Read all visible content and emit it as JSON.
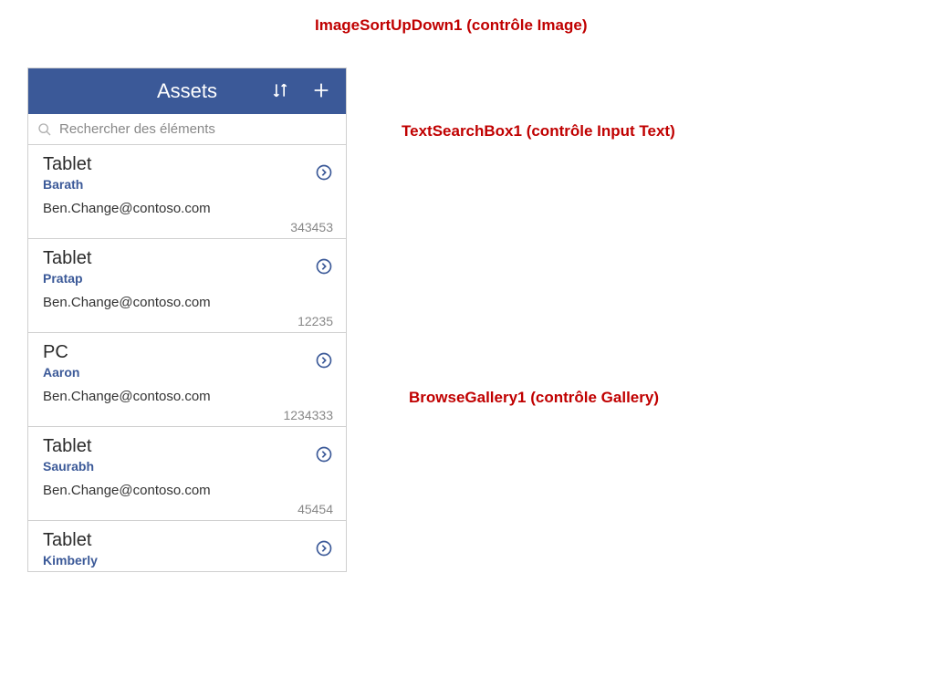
{
  "annotations": {
    "top": "ImageSortUpDown1 (contrôle Image)",
    "search": "TextSearchBox1 (contrôle Input Text)",
    "gallery": "BrowseGallery1 (contrôle Gallery)"
  },
  "header": {
    "title": "Assets"
  },
  "search": {
    "placeholder": "Rechercher des éléments"
  },
  "items": [
    {
      "title": "Tablet",
      "subtitle": "Barath",
      "email": "Ben.Change@contoso.com",
      "id": "343453",
      "partial": false
    },
    {
      "title": "Tablet",
      "subtitle": "Pratap",
      "email": "Ben.Change@contoso.com",
      "id": "12235",
      "partial": false
    },
    {
      "title": "PC",
      "subtitle": "Aaron",
      "email": "Ben.Change@contoso.com",
      "id": "1234333",
      "partial": false
    },
    {
      "title": "Tablet",
      "subtitle": "Saurabh",
      "email": "Ben.Change@contoso.com",
      "id": "45454",
      "partial": false
    },
    {
      "title": "Tablet",
      "subtitle": "Kimberly",
      "email": "",
      "id": "",
      "partial": true
    }
  ]
}
